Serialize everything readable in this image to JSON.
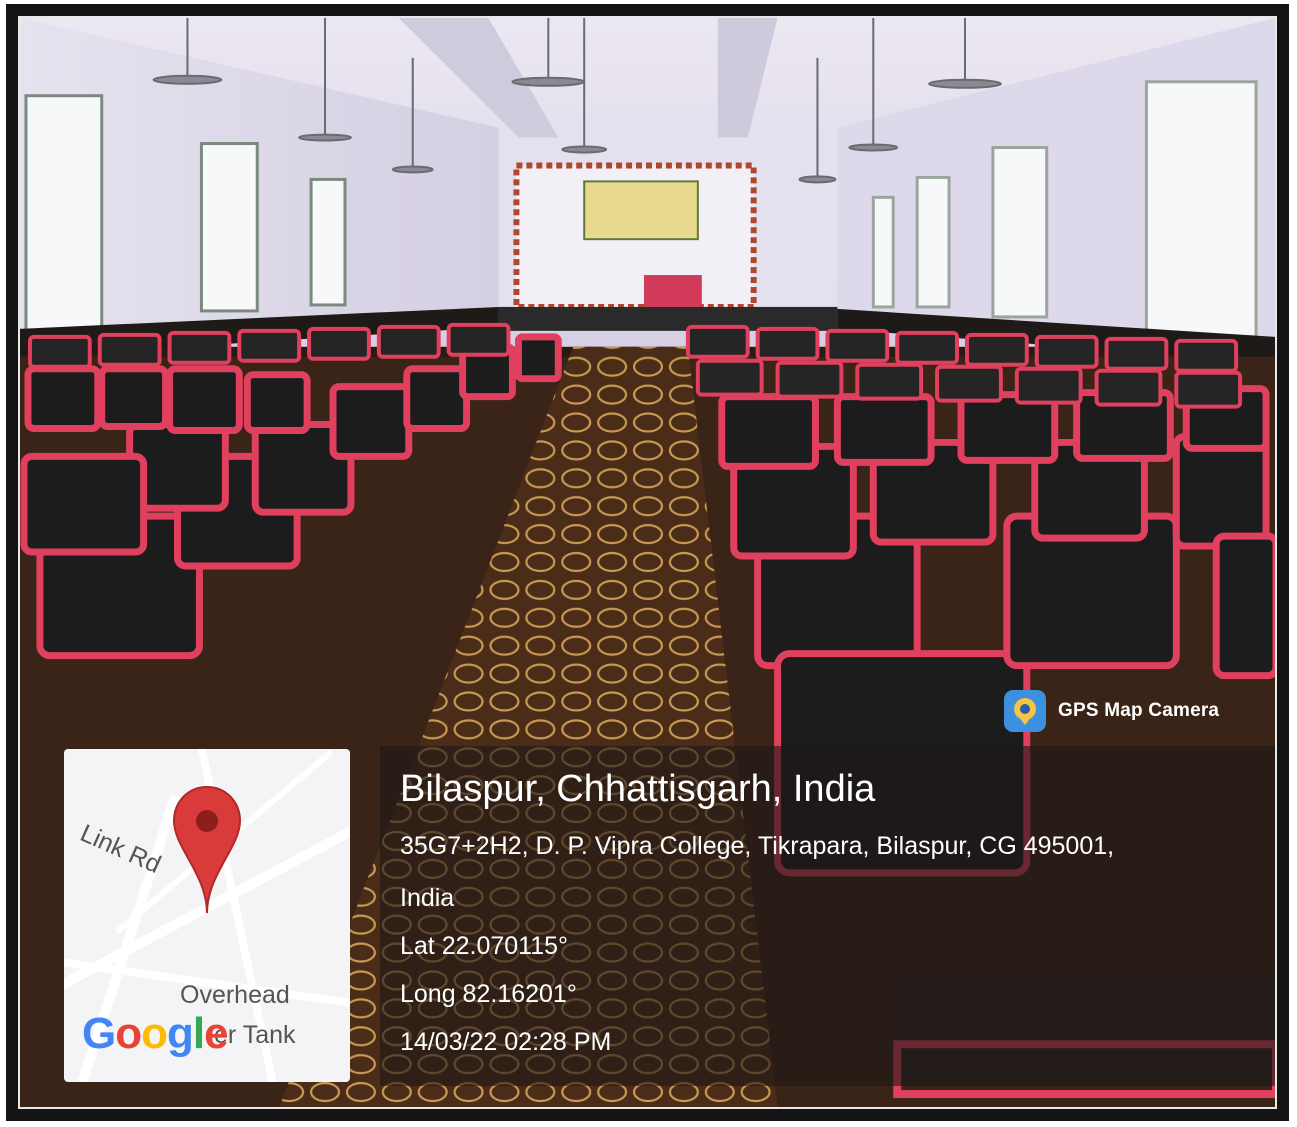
{
  "gps_badge": {
    "label": "GPS Map Camera",
    "icon": "gps-map-camera-icon"
  },
  "location": {
    "title": "Bilaspur, Chhattisgarh, India",
    "address_line1": "35G7+2H2, D. P. Vipra College, Tikrapara, Bilaspur, CG 495001,",
    "address_line2": "India",
    "latitude": "Lat 22.070115°",
    "longitude": "Long 82.16201°",
    "timestamp": "14/03/22 02:28 PM"
  },
  "map": {
    "road_label": "Link Rd",
    "landmark_line1": "Overhead",
    "landmark_line2": "er Tank",
    "google": [
      "G",
      "o",
      "o",
      "g",
      "l",
      "e"
    ],
    "pin_color": "#d93a3a",
    "google_colors": [
      "#4285f4",
      "#ea4335",
      "#fbbc05",
      "#4285f4",
      "#34a853",
      "#ea4335"
    ]
  },
  "colors": {
    "chair_frame": "#e0405e",
    "chair_back": "#1e1e1e",
    "wall": "#ddd8ea",
    "carpet": "#5a3a22"
  }
}
